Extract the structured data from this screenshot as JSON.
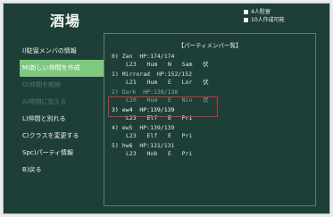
{
  "title": "酒場",
  "status": [
    "4人駐留",
    "10人作成可能"
  ],
  "menu": [
    {
      "label": "I)駐留メンバの情報"
    },
    {
      "label": "M)新しい仲間を作成"
    },
    {
      "label": "D)仲間を削除"
    },
    {
      "label": "A)仲間に加える"
    },
    {
      "label": "L)仲間と別れる"
    },
    {
      "label": "C)クラスを変更する"
    },
    {
      "label": "Spc)パーティ情報"
    },
    {
      "label": "B)戻る"
    }
  ],
  "party_panel": {
    "title": "【パーティメンバー覧】",
    "members": [
      {
        "slot": "0)",
        "name": "Zan",
        "hp": "HP:174/174",
        "level": "L23",
        "race": "Hum",
        "gender": "N",
        "cls": "Sam",
        "status": "伏"
      },
      {
        "slot": "1)",
        "name": "Mirrorad",
        "hp": "HP:152/152",
        "level": "L21",
        "race": "Hum",
        "gender": "E",
        "cls": "Lor",
        "status": "伏"
      },
      {
        "slot": "2)",
        "name": "Dark",
        "hp": "HP:138/138",
        "level": "L20",
        "race": "Hum",
        "gender": "E",
        "cls": "Nin",
        "status": "伏"
      },
      {
        "slot": "3)",
        "name": "ew4",
        "hp": "HP:139/139",
        "level": "L23",
        "race": "Elf",
        "gender": "E",
        "cls": "Pri",
        "status": ""
      },
      {
        "slot": "4)",
        "name": "ew5",
        "hp": "HP:139/139",
        "level": "L23",
        "race": "Elf",
        "gender": "E",
        "cls": "Pri",
        "status": ""
      },
      {
        "slot": "5)",
        "name": "hw6",
        "hp": "HP:131/131",
        "level": "L23",
        "race": "Hob",
        "gender": "E",
        "cls": "Pri",
        "status": ""
      }
    ]
  }
}
